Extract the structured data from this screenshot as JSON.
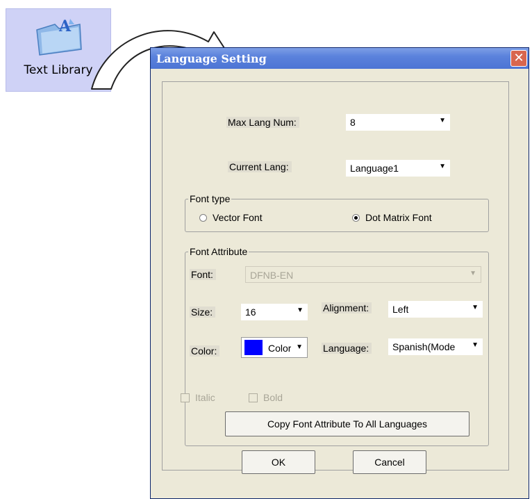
{
  "desktop": {
    "icon_label": "Text Library",
    "icon": "folder-text-icon"
  },
  "dialog": {
    "title": "Language Setting",
    "close_glyph": "✕",
    "max_lang": {
      "label": "Max Lang Num:",
      "value": "8"
    },
    "current_lang": {
      "label": "Current Lang:",
      "value": "Language1"
    },
    "font_type": {
      "legend": "Font type",
      "vector": "Vector Font",
      "dot_matrix": "Dot Matrix Font",
      "selected": "dot_matrix"
    },
    "font_attribute": {
      "legend": "Font Attribute",
      "font_label": "Font:",
      "font_value": "DFNB-EN",
      "size_label": "Size:",
      "size_value": "16",
      "alignment_label": "Alignment:",
      "alignment_value": "Left",
      "color_label": "Color:",
      "color_button": "Color",
      "color_value": "#0000ff",
      "language_label": "Language:",
      "language_value": "Spanish(Mode",
      "italic": "Italic",
      "bold": "Bold",
      "copy_button": "Copy Font Attribute To All Languages"
    },
    "ok": "OK",
    "cancel": "Cancel"
  }
}
